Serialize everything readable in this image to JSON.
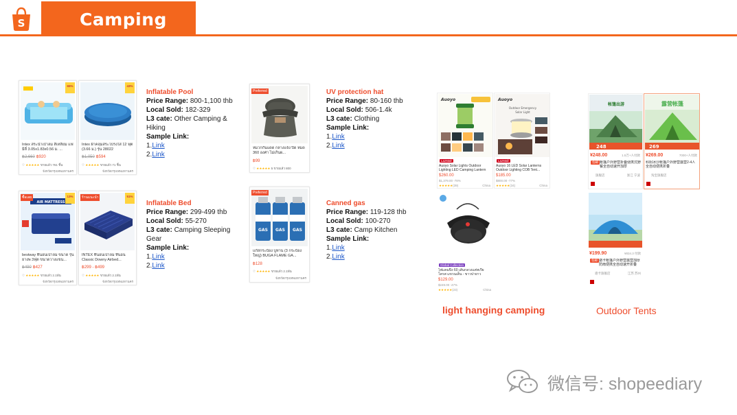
{
  "header": {
    "title": "Camping"
  },
  "products": [
    {
      "name": "Inflatable Pool",
      "price_range_label": "Price Range:",
      "price_range": "800-1,100 thb",
      "local_sold_label": "Local Sold:",
      "local_sold": "182-329",
      "l3_label": "L3 cate:",
      "l3": "Other Camping & Hiking",
      "sample_label": "Sample Link:",
      "link1_prefix": "1.",
      "link1": "Link",
      "link2_prefix": "2.",
      "link2": "Link"
    },
    {
      "name": "UV protection hat",
      "price_range_label": "Price Range:",
      "price_range": "80-160 thb",
      "local_sold_label": "Local Sold:",
      "local_sold": "506-1.4k",
      "l3_label": "L3 cate:",
      "l3": "Clothing",
      "sample_label": "Sample Link:",
      "link1_prefix": "1.",
      "link1": "Link",
      "link2_prefix": "2.",
      "link2": "Link"
    },
    {
      "name": "Inflatable Bed",
      "price_range_label": "Price Range:",
      "price_range": "299-499 thb",
      "local_sold_label": "Local Sold:",
      "local_sold": "55-270",
      "l3_label": "L3 cate:",
      "l3": "Camping Sleeping Gear",
      "sample_label": "Sample Link:",
      "link1_prefix": "1.",
      "link1": "Link",
      "link2_prefix": "2.",
      "link2": "Link"
    },
    {
      "name": "Canned gas",
      "price_range_label": "Price Range:",
      "price_range": "119-128 thb",
      "local_sold_label": "Local Sold:",
      "local_sold": "100-270",
      "l3_label": "L3 cate:",
      "l3": "Camp Kitchen",
      "sample_label": "Sample Link:",
      "link1_prefix": "1.",
      "link1": "Link",
      "link2_prefix": "2.",
      "link2": "Link"
    }
  ],
  "cards": {
    "pool1": {
      "name": "Intex สระน้ำเป่าลม สี่เหลี่ยม แฟมิลี่ 3.05x1.83x0.56 ม. ...",
      "old": "฿2,660",
      "price": "฿920",
      "sold": "ขายแล้ว 761 ชิ้น",
      "loc": "จังหวัดกรุงเทพมหานคร",
      "disc": "65%"
    },
    "pool2": {
      "name": "Intex ผ้าคลุมสระโปรงใส 12 ฟุต (3.66 ม.) รุ่น 28022",
      "old": "฿1,050",
      "price": "฿594",
      "sold": "ขายแล้ว 71 ชิ้น",
      "loc": "จังหวัดกรุงเทพมหานคร",
      "disc": "43%"
    },
    "hat": {
      "badge": "Preferred",
      "name": "หมวกกันแดด กลางแจ้ง ปิด หมด 360 องศา ไม่เกินผ...",
      "price": "฿99",
      "sold": "5 ขายแล้ว 800",
      "loc": ""
    },
    "bed1": {
      "badge": "ซื้อเลย",
      "name": "bestway ที่นอนเป่าลม ขนาด รุ่นยางพ 3ฟุต ขนาดวางแขน...",
      "banner": "AIR MATTRESS",
      "old": "฿490",
      "price": "฿427",
      "sold": "ขายแล้ว 2.1พัน",
      "loc": "จังหวัดกรุงเทพมหานคร",
      "disc": "13%"
    },
    "bed2": {
      "badge": "ร้านแนะนำ",
      "name": "INTEX ที่นอนเป่าลม ที่นอน Classic Downy Airbed...",
      "price": "฿299 - ฿499",
      "sold": "ขายแล้ว 2.1พัน",
      "loc": "จังหวัดกรุงเทพมหานคร",
      "disc": "51%"
    },
    "gas": {
      "badge": "Preferred",
      "name": "แก๊สกระป๋อง บูทาน (3 กระป๋อง ใหญ่) BUGA FLAME GA...",
      "price": "฿128",
      "sold": "ขายแล้ว 2.1พัน",
      "loc": "จังหวัดกรุงเทพมหานคร",
      "can_text": "BUGA FLAME GAS"
    }
  },
  "lights": {
    "label": "light hanging camping",
    "tile1": {
      "brand": "Auoyo",
      "chip": "LazMall",
      "name": "Auoyo Solar Lights Outdoor Lighting LED Camping Lantern",
      "price": "$260.00",
      "old": "$1,379.00 -78%",
      "sold": "(39)",
      "loc": "China",
      "art": "Solar"
    },
    "tile2": {
      "brand": "Auoyo",
      "chip": "LazMall",
      "name": "Auoyo 16 LED Solar Lanterns Outdoor Lighting COB Tent...",
      "price": "$185.00",
      "old": "$800.00 -77%",
      "sold": "(34)",
      "loc": "China",
      "art": "Outdoor Emergency Solar Light"
    },
    "tile3": {
      "chip": "Global Collection",
      "name": "ไฟแคมปิ้ง 60 เส้นกลวงแค่ทเรียโครส แขวนเต็น - ขาวปายาว",
      "price": "$129.00",
      "old": "$249.00 -47%",
      "sold": "(23)",
      "loc": "China"
    }
  },
  "tents": {
    "label": "Outdoor Tents",
    "tile1": {
      "price": "¥248.00",
      "sold": "1.5万+人付款",
      "name": "帐篷户外野营折叠便携式野餐全自动速开加厚",
      "shop": "旗舰店",
      "loc": "浙江 宁波",
      "banner": "248",
      "art": "帐篷出游 揣梦好帐篷"
    },
    "tile2": {
      "price": "¥269.00",
      "sold": "7000+人付款",
      "name": "科阳冰沙帐篷户外野营露营2-4人全自动便携折叠",
      "shop": "淘宝旗舰店",
      "loc": "",
      "banner": "269",
      "art": "露营帐篷"
    },
    "tile3": {
      "price": "¥199.90",
      "sold": "¥834.3 付款",
      "name": "骆卡帐篷户外野营露营加厚防雨便携全自动速开折叠",
      "shop": "骆卡旗舰店",
      "loc": "江苏 苏州"
    }
  },
  "watermark": "微信号: shopeediary"
}
